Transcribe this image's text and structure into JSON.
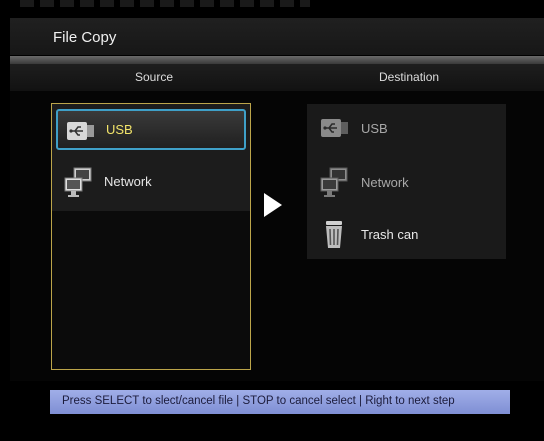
{
  "title": "File Copy",
  "headers": {
    "source": "Source",
    "destination": "Destination"
  },
  "source": {
    "items": [
      {
        "label": "USB",
        "icon": "usb-icon",
        "selected": true
      },
      {
        "label": "Network",
        "icon": "network-icon",
        "selected": false
      }
    ]
  },
  "destination": {
    "items": [
      {
        "label": "USB",
        "icon": "usb-icon"
      },
      {
        "label": "Network",
        "icon": "network-icon"
      },
      {
        "label": "Trash can",
        "icon": "trash-can-icon"
      }
    ]
  },
  "hint": "Press SELECT to slect/cancel file | STOP to  cancel select | Right to next step",
  "colors": {
    "selection_border": "#3fa0c8",
    "selected_text": "#f2e46a",
    "panel_border": "#bca54a",
    "hint_bar": "#8f9ee0"
  }
}
